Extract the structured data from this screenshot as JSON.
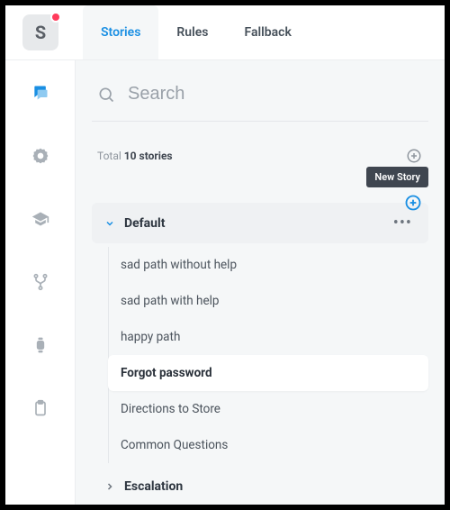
{
  "logo": {
    "letter": "S"
  },
  "tabs": [
    {
      "label": "Stories",
      "active": true
    },
    {
      "label": "Rules",
      "active": false
    },
    {
      "label": "Fallback",
      "active": false
    }
  ],
  "search": {
    "placeholder": "Search"
  },
  "total": {
    "prefix": "Total ",
    "count": "10 stories"
  },
  "tooltip": {
    "label": "New Story"
  },
  "groups": [
    {
      "title": "Default",
      "expanded": true,
      "stories": [
        {
          "title": "sad path without help",
          "selected": false
        },
        {
          "title": "sad path with help",
          "selected": false
        },
        {
          "title": "happy path",
          "selected": false
        },
        {
          "title": "Forgot password",
          "selected": true
        },
        {
          "title": "Directions to Store",
          "selected": false
        },
        {
          "title": "Common Questions",
          "selected": false
        }
      ]
    },
    {
      "title": "Escalation",
      "expanded": false,
      "stories": []
    }
  ]
}
